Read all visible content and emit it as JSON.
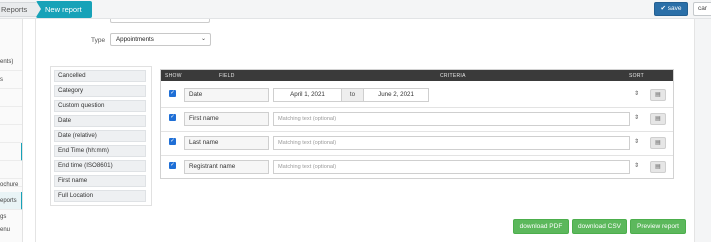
{
  "breadcrumb": {
    "parent": "Reports",
    "current": "New report"
  },
  "toolbar": {
    "save_label": "save",
    "cancel_label": "car"
  },
  "sidebar": {
    "items": [
      {
        "label": "ents)"
      },
      {
        "label": "s"
      },
      {
        "label": ""
      },
      {
        "label": ""
      },
      {
        "label": ""
      },
      {
        "label": ""
      },
      {
        "label": ""
      },
      {
        "label": ""
      },
      {
        "label": "ochure"
      },
      {
        "label": "eports"
      },
      {
        "label": "gs"
      },
      {
        "label": "enu"
      }
    ]
  },
  "report_form": {
    "type_label": "Type",
    "type_value": "Appointments"
  },
  "available_fields": [
    "Cancelled",
    "Category",
    "Custom question",
    "Date",
    "Date (relative)",
    "End Time (hh:mm)",
    "End time (ISO8601)",
    "First name",
    "Full Location"
  ],
  "criteria_table": {
    "headers": {
      "show": "SHOW",
      "field": "FIELD",
      "criteria": "CRITERIA",
      "sort": "SORT"
    },
    "rows": [
      {
        "field": "Date",
        "from": "April 1, 2021",
        "to_label": "to",
        "to": "June 2, 2021"
      },
      {
        "field": "First name",
        "placeholder": "Matching text (optional)"
      },
      {
        "field": "Last name",
        "placeholder": "Matching text (optional)"
      },
      {
        "field": "Registrant name",
        "placeholder": "Matching text (optional)"
      }
    ]
  },
  "actions": {
    "download_pdf": "download PDF",
    "download_csv": "download CSV",
    "preview": "Preview report"
  },
  "icons": {
    "save": "check-icon",
    "dropdown": "chevron-down-icon",
    "sort": "sort-icon",
    "delete": "trash-icon",
    "checkbox": "checkbox-checked-icon"
  },
  "colors": {
    "accent": "#17a2b8",
    "save_button": "#2a6fa8",
    "action_buttons": "#5cb85c",
    "table_header": "#3a3a3a",
    "checkbox": "#1f6fd6"
  }
}
